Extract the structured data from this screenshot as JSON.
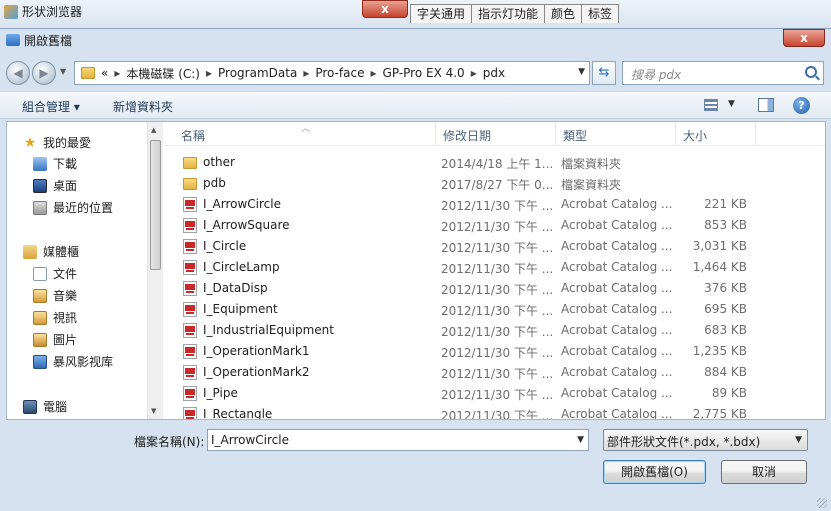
{
  "background_app": {
    "title": "形状浏览器",
    "tabs": [
      "字关通用",
      "指示灯功能",
      "颜色",
      "标签"
    ],
    "close_label": "x"
  },
  "dialog": {
    "title": "開啟舊檔",
    "close_label": "x"
  },
  "address": {
    "chevron": "«",
    "crumbs": [
      "本機磁碟 (C:)",
      "ProgramData",
      "Pro-face",
      "GP-Pro EX 4.0",
      "pdx"
    ],
    "separator": "▸"
  },
  "search": {
    "placeholder": "搜尋 pdx"
  },
  "toolbar": {
    "organize_label": "組合管理 ▾",
    "new_folder_label": "新增資料夾",
    "help_label": "?"
  },
  "nav": {
    "favorites": {
      "label": "我的最愛",
      "items": [
        "下載",
        "桌面",
        "最近的位置"
      ]
    },
    "libraries": {
      "label": "媒體櫃",
      "items": [
        "文件",
        "音樂",
        "視訊",
        "圖片",
        "暴风影视库"
      ]
    },
    "computer": {
      "label": "電腦"
    }
  },
  "columns": {
    "name": "名稱",
    "date": "修改日期",
    "type": "類型",
    "size": "大小"
  },
  "files": [
    {
      "name": "other",
      "date": "2014/4/18 上午 1...",
      "type": "檔案資料夾",
      "size": "",
      "kind": "folder"
    },
    {
      "name": "pdb",
      "date": "2017/8/27 下午 0...",
      "type": "檔案資料夾",
      "size": "",
      "kind": "folder"
    },
    {
      "name": "I_ArrowCircle",
      "date": "2012/11/30 下午 ...",
      "type": "Acrobat Catalog ...",
      "size": "221 KB",
      "kind": "pdx"
    },
    {
      "name": "I_ArrowSquare",
      "date": "2012/11/30 下午 ...",
      "type": "Acrobat Catalog ...",
      "size": "853 KB",
      "kind": "pdx"
    },
    {
      "name": "I_Circle",
      "date": "2012/11/30 下午 ...",
      "type": "Acrobat Catalog ...",
      "size": "3,031 KB",
      "kind": "pdx"
    },
    {
      "name": "I_CircleLamp",
      "date": "2012/11/30 下午 ...",
      "type": "Acrobat Catalog ...",
      "size": "1,464 KB",
      "kind": "pdx"
    },
    {
      "name": "I_DataDisp",
      "date": "2012/11/30 下午 ...",
      "type": "Acrobat Catalog ...",
      "size": "376 KB",
      "kind": "pdx"
    },
    {
      "name": "I_Equipment",
      "date": "2012/11/30 下午 ...",
      "type": "Acrobat Catalog ...",
      "size": "695 KB",
      "kind": "pdx"
    },
    {
      "name": "I_IndustrialEquipment",
      "date": "2012/11/30 下午 ...",
      "type": "Acrobat Catalog ...",
      "size": "683 KB",
      "kind": "pdx"
    },
    {
      "name": "I_OperationMark1",
      "date": "2012/11/30 下午 ...",
      "type": "Acrobat Catalog ...",
      "size": "1,235 KB",
      "kind": "pdx"
    },
    {
      "name": "I_OperationMark2",
      "date": "2012/11/30 下午 ...",
      "type": "Acrobat Catalog ...",
      "size": "884 KB",
      "kind": "pdx"
    },
    {
      "name": "I_Pipe",
      "date": "2012/11/30 下午 ...",
      "type": "Acrobat Catalog ...",
      "size": "89 KB",
      "kind": "pdx"
    },
    {
      "name": "I_Rectangle",
      "date": "2012/11/30 下午 ...",
      "type": "Acrobat Catalog ...",
      "size": "2,775 KB",
      "kind": "pdx"
    }
  ],
  "bottom": {
    "filename_label": "檔案名稱(N):",
    "filename_value": "I_ArrowCircle",
    "filter_value": "部件形狀文件(*.pdx, *.bdx)",
    "open_label": "開啟舊檔(O)",
    "cancel_label": "取消"
  }
}
